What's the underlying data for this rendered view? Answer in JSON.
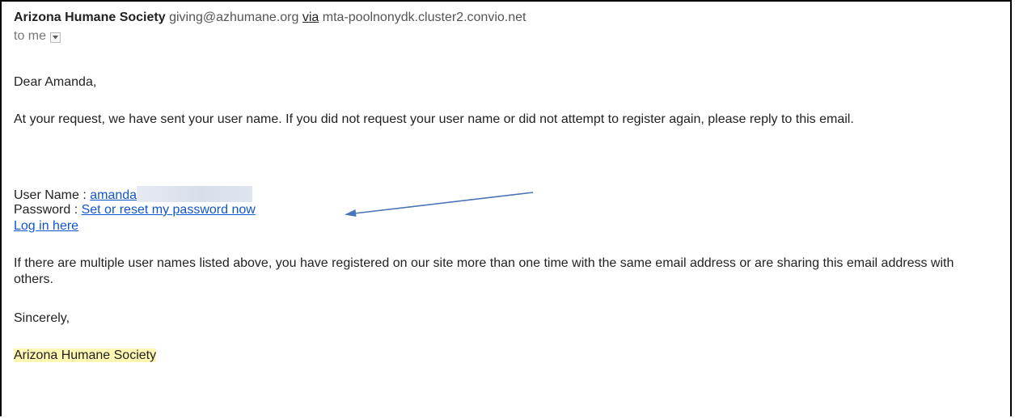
{
  "email": {
    "sender_name": "Arizona Humane Society",
    "sender_email": "giving@azhumane.org",
    "via_label": "via",
    "via_host": "mta-poolnonydk.cluster2.convio.net",
    "to_line": "to me"
  },
  "body": {
    "greeting": "Dear Amanda,",
    "paragraph1": "At your request, we have sent your user name. If you did not request your user name or did not attempt to register again, please reply to this email.",
    "username_label": "User Name : ",
    "username_link": "amanda",
    "password_label": "Password : ",
    "password_link": "Set or reset my password now",
    "login_link": "Log in here",
    "paragraph2": "If there are multiple user names listed above, you have registered on our site more than one time with the same email address or are sharing this email address with others.",
    "closing": "Sincerely,",
    "signature": "Arizona Humane Society"
  },
  "colors": {
    "link": "#1155cc",
    "highlight": "#fff7b3",
    "arrow": "#4a74b8"
  },
  "icons": {
    "dropdown": "chevron-down-icon",
    "annotation": "arrow-icon"
  }
}
